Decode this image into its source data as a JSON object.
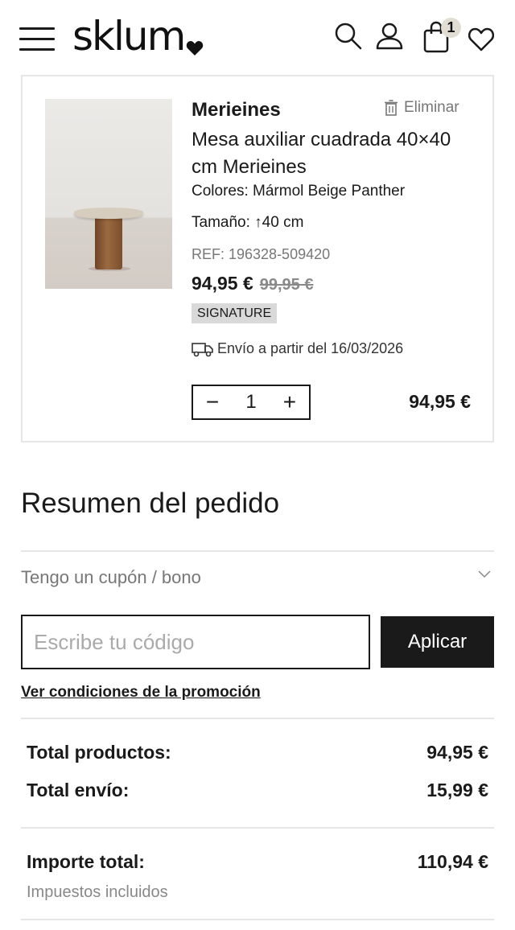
{
  "header": {
    "logo_text": "sklum",
    "cart_count": "1",
    "icons": [
      "menu-icon",
      "search-icon",
      "user-icon",
      "shopping-bag-icon",
      "heart-icon"
    ]
  },
  "product": {
    "brand": "Merieines",
    "remove_label": "Eliminar",
    "name": "Mesa auxiliar cuadrada 40×40 cm Merieines",
    "colors": "Colores: Mármol Beige Panther",
    "size": "Tamaño: ↑40 cm",
    "ref": "REF: 196328-509420",
    "price": "94,95 €",
    "old_price": "99,95 €",
    "badge": "SIGNATURE",
    "shipping": "Envío a partir del 16/03/2026",
    "quantity": "1",
    "line_total": "94,95 €"
  },
  "summary": {
    "title": "Resumen del pedido",
    "coupon_label": "Tengo un cupón / bono",
    "code_placeholder": "Escribe tu código",
    "apply_label": "Aplicar",
    "promo_link": "Ver condiciones de la promoción",
    "products_label": "Total productos:",
    "products_value": "94,95 €",
    "shipping_label": "Total envío:",
    "shipping_value": "15,99 €",
    "total_label": "Importe total:",
    "total_value": "110,94 €",
    "tax_note": "Impuestos incluidos"
  },
  "colors": {
    "text": "#1a1a1a",
    "muted": "#777777",
    "badge_bg": "#d9d9d9",
    "cart_badge_bg": "#e2ddd2",
    "button_bg": "#1a1a1a",
    "border": "#e6e6e6"
  }
}
